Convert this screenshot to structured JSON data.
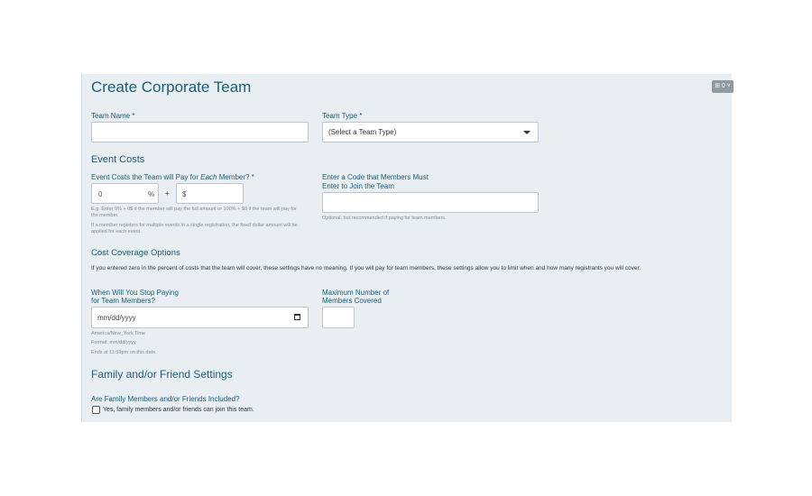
{
  "page": {
    "title": "Create Corporate Team",
    "corner_badge": "⊞ 0 ˅"
  },
  "team_name": {
    "label": "Team Name *",
    "value": ""
  },
  "team_type": {
    "label": "Team Type *",
    "selected": "(Select a Team Type)"
  },
  "event_costs": {
    "heading": "Event Costs",
    "pay_label_prefix": "Event Costs the Team will Pay for ",
    "pay_label_each": "Each",
    "pay_label_suffix": " Member? *",
    "percent_value": "0",
    "percent_symbol": "%",
    "plus_symbol": "+",
    "dollar_symbol": "$",
    "dollar_value": "",
    "help1": "E.g. Enter 0% + 0$ if the member will pay the full amount or 100% + $0 if the team will pay for the member.",
    "help2": "If a member registers for multiple events in a single registration, the fixed dollar amount will be applied for each event.",
    "code_label_line1": "Enter a Code that Members Must",
    "code_label_line2": "Enter to Join the Team",
    "code_value": "",
    "code_help": "Optional, but recommended if paying for team members."
  },
  "cost_coverage": {
    "heading": "Cost Coverage Options",
    "description": "If you entered zero in the percent of costs that the team will cover, these settings have no meaning. If you will pay for team members, these settings allow you to limit when and how many registrants you will cover.",
    "stop_label_line1": "When Will You Stop Paying",
    "stop_label_line2": "for Team Members?",
    "date_placeholder": "mm/dd/yyyy",
    "tz": "America/New_York Time",
    "format": "Format: mm/dd/yyyy",
    "ends": "Ends at 11:59pm on this date.",
    "max_label_line1": "Maximum Number of",
    "max_label_line2": "Members Covered",
    "max_value": ""
  },
  "family": {
    "heading": "Family and/or Friend Settings",
    "question": "Are Family Members and/or Friends Included?",
    "checkbox_label": "Yes, family members and/or friends can join this team."
  }
}
